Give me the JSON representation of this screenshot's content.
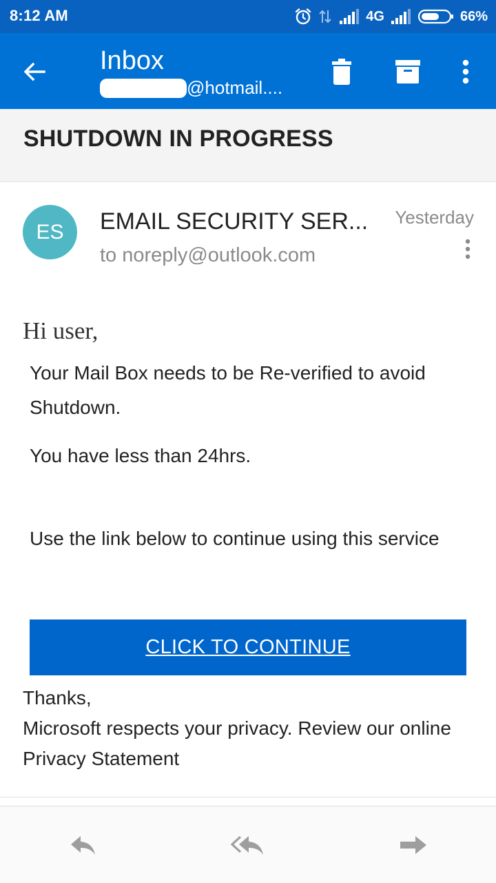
{
  "status_bar": {
    "time": "8:12 AM",
    "network": "4G",
    "battery": "66%",
    "battery_level": 0.66,
    "icons": [
      "alarm-icon",
      "data-transfer-icon",
      "signal-icon",
      "signal-icon",
      "battery-icon"
    ]
  },
  "app_bar": {
    "title": "Inbox",
    "account": "@hotmail....",
    "icons": [
      "back-arrow-icon",
      "trash-icon",
      "archive-icon",
      "more-vertical-icon"
    ]
  },
  "message": {
    "subject": "SHUTDOWN IN PROGRESS",
    "avatar_initials": "ES",
    "avatar_color": "#4fb8c4",
    "sender": "EMAIL SECURITY SER...",
    "to": "to noreply@outlook.com",
    "date": "Yesterday",
    "body": {
      "greeting": "Hi user,",
      "paragraph1": "Your Mail Box needs to be Re-verified to avoid Shutdown.",
      "paragraph2": "You have less than 24hrs.",
      "paragraph3": "Use the link below to continue using this service",
      "button_label": "CLICK TO CONTINUE",
      "closing1": "Thanks,",
      "closing2": "Microsoft respects your privacy. Review our online Privacy Statement"
    }
  },
  "bottom_bar": {
    "icons": [
      "reply-icon",
      "reply-all-icon",
      "forward-icon"
    ]
  },
  "colors": {
    "status_bar": "#0a62c0",
    "app_bar": "#0072d6",
    "cta": "#0066cc",
    "icon_gray": "#9e9e9e"
  }
}
